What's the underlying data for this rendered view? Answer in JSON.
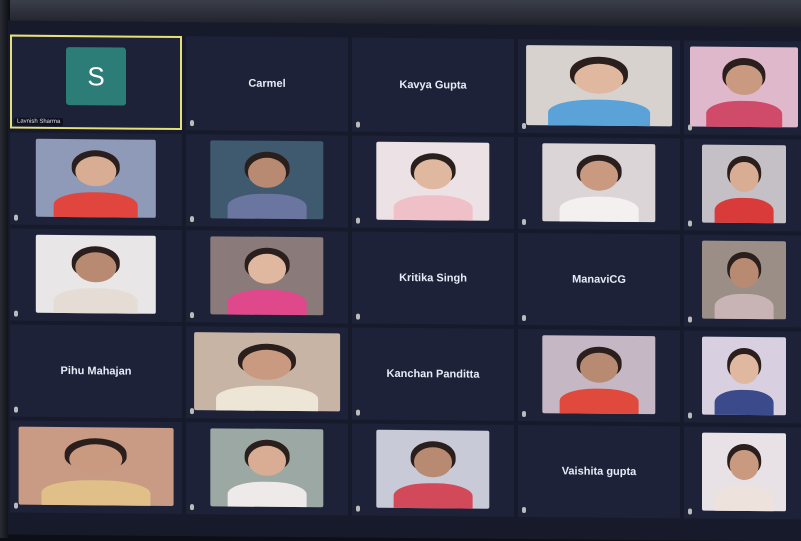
{
  "meeting": {
    "participants": [
      {
        "name": "Lavnish Sharma",
        "type": "avatar",
        "initial": "S",
        "avatar_color": "#2c7d78",
        "active": true
      },
      {
        "name": "Carmel",
        "type": "name"
      },
      {
        "name": "Kavya Gupta",
        "type": "name"
      },
      {
        "name": "",
        "type": "video",
        "bg": "#d8d2cf",
        "shirt": "#5aa2d8",
        "wide": true
      },
      {
        "name": "",
        "type": "video",
        "bg": "#e0b8cc",
        "shirt": "#d04a6a",
        "wide": true
      },
      {
        "name": "",
        "type": "video",
        "bg": "#8f99b8",
        "shirt": "#e0453e"
      },
      {
        "name": "",
        "type": "video",
        "bg": "#3f5a6f",
        "shirt": "#6a76a0"
      },
      {
        "name": "",
        "type": "video",
        "bg": "#ece2e6",
        "shirt": "#f0c0c8"
      },
      {
        "name": "",
        "type": "video",
        "bg": "#dcd5d8",
        "shirt": "#f4f0f0"
      },
      {
        "name": "",
        "type": "video",
        "bg": "#c4c0c6",
        "shirt": "#d93a3a"
      },
      {
        "name": "",
        "type": "video",
        "bg": "#e8e6e6",
        "shirt": "#e5dcd5"
      },
      {
        "name": "",
        "type": "video",
        "bg": "#8a7a7a",
        "shirt": "#e0488c"
      },
      {
        "name": "Kritika Singh",
        "type": "name"
      },
      {
        "name": "ManaviCG",
        "type": "name"
      },
      {
        "name": "",
        "type": "video",
        "bg": "#9a8e86",
        "shirt": "#c8b4b4"
      },
      {
        "name": "Pihu Mahajan",
        "type": "name"
      },
      {
        "name": "",
        "type": "video",
        "bg": "#c7b4a4",
        "shirt": "#ede6d6",
        "wide": true
      },
      {
        "name": "Kanchan Panditta",
        "type": "name"
      },
      {
        "name": "",
        "type": "video",
        "bg": "#c6b7c4",
        "shirt": "#e04a3c"
      },
      {
        "name": "",
        "type": "video",
        "bg": "#d8d0e0",
        "shirt": "#3b4a8a"
      },
      {
        "name": "",
        "type": "video",
        "bg": "#c99a84",
        "shirt": "#e0c088",
        "wide": true
      },
      {
        "name": "",
        "type": "video",
        "bg": "#9ca8a4",
        "shirt": "#efeaea"
      },
      {
        "name": "",
        "type": "video",
        "bg": "#c8cad8",
        "shirt": "#d24a5a"
      },
      {
        "name": "Vaishita gupta",
        "type": "name"
      },
      {
        "name": "",
        "type": "video",
        "bg": "#e8e2e6",
        "shirt": "#eee2dc"
      }
    ]
  }
}
